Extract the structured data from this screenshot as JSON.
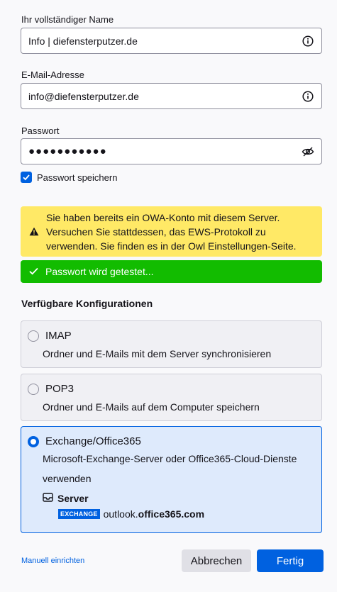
{
  "name_field": {
    "label": "Ihr vollständiger Name",
    "value": "Info | diefensterputzer.de",
    "icon": "info-icon"
  },
  "email_field": {
    "label": "E-Mail-Adresse",
    "value": "info@diefensterputzer.de",
    "icon": "info-icon"
  },
  "password_field": {
    "label": "Passwort",
    "value": "●●●●●●●●●●●",
    "icon": "eye-slash-icon"
  },
  "remember_password": {
    "label": "Passwort speichern",
    "checked": true
  },
  "warning": {
    "text": "Sie haben bereits ein OWA-Konto mit diesem Server. Versuchen Sie stattdessen, das EWS-Protokoll zu verwenden. Sie finden es in der Owl Einstellungen-Seite.",
    "icon": "warning-icon"
  },
  "status": {
    "text": "Passwort wird getestet...",
    "icon": "checkmark-icon"
  },
  "configurations": {
    "title": "Verfügbare Konfigurationen",
    "options": [
      {
        "name": "IMAP",
        "description": "Ordner und E-Mails mit dem Server synchronisieren",
        "selected": false
      },
      {
        "name": "POP3",
        "description": "Ordner und E-Mails auf dem Computer speichern",
        "selected": false
      },
      {
        "name": "Exchange/Office365",
        "description": "Microsoft-Exchange-Server oder Office365-Cloud-Dienste verwenden",
        "selected": true,
        "server_label": "Server",
        "protocol_badge": "EXCHANGE",
        "host_prefix": "outlook.",
        "host_domain": "office365.com"
      }
    ]
  },
  "footer": {
    "manual_link": "Manuell einrichten",
    "cancel_label": "Abbrechen",
    "done_label": "Fertig"
  },
  "colors": {
    "accent": "#0061e0",
    "warning_bg": "#ffe966",
    "success_bg": "#12bc00"
  }
}
